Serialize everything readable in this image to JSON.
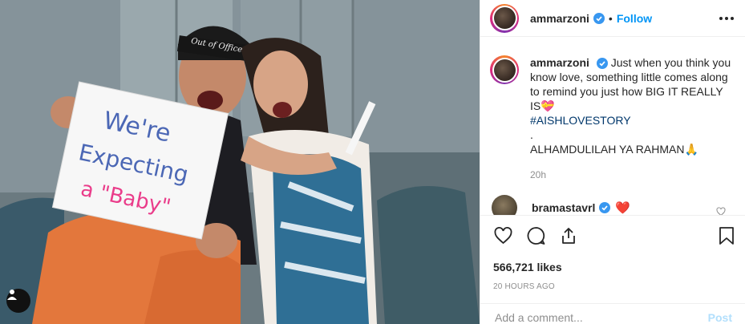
{
  "post": {
    "username": "ammarzoni",
    "verified": true,
    "follow_label": "Follow",
    "separator": "•",
    "caption": {
      "text": "Just when you think you know love, something little comes along to remind you just how BIG IT REALLY IS",
      "emoji": "💝",
      "hashtag": "#AISHLOVESTORY",
      "dot_line": ".",
      "closing": "ALHAMDULILAH YA RAHMAN",
      "closing_emoji": "🙏",
      "time": "20h"
    },
    "comments": [
      {
        "username": "bramastavrl",
        "verified": true,
        "text": "❤️"
      }
    ],
    "likes": "566,721 likes",
    "timestamp": "20 HOURS AGO",
    "add_comment_placeholder": "Add a comment...",
    "post_label": "Post"
  },
  "photo": {
    "sign_lines": [
      "We're",
      "Expecting",
      "a \"Baby\""
    ],
    "headband_text": "Out of Office"
  },
  "colors": {
    "accent": "#0095f6",
    "post_disabled": "#b2dffc",
    "hashtag": "#00376b",
    "muted": "#8e8e8e"
  },
  "icons": [
    "tag-user-icon",
    "verified-icon",
    "more-options-icon",
    "like-icon",
    "comment-icon",
    "share-icon",
    "save-icon"
  ]
}
